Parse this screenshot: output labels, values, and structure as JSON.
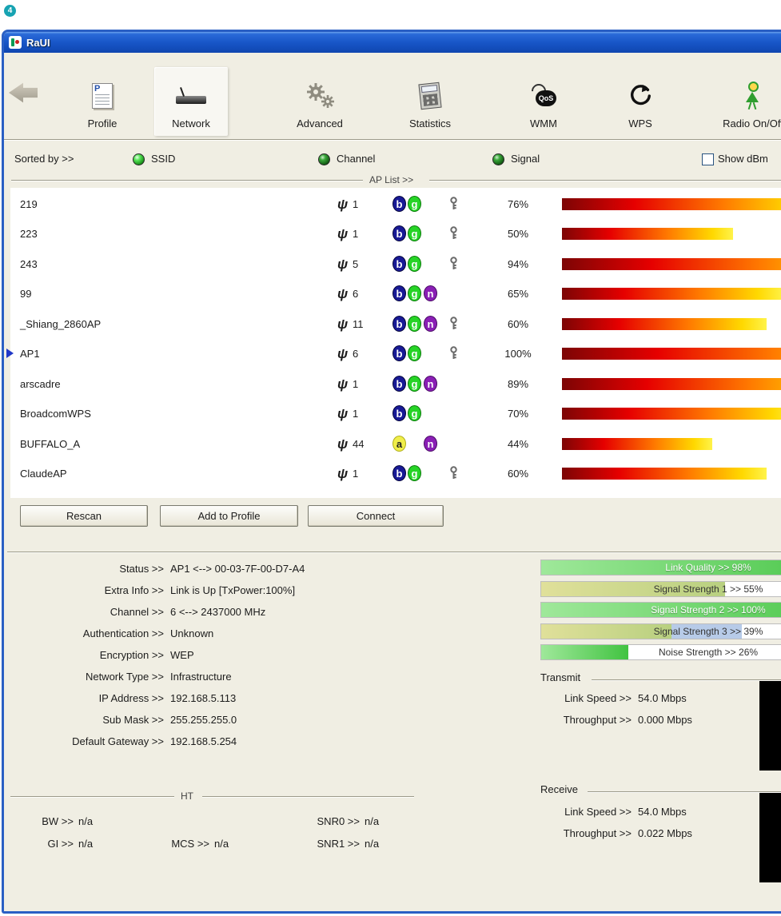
{
  "page": {
    "badge": "4"
  },
  "window": {
    "title": "RaUI"
  },
  "icons": {
    "profile_letter": "P",
    "wmm_text": "QoS",
    "channel_glyph": "psi"
  },
  "toolbar": {
    "items": [
      {
        "label": "Profile"
      },
      {
        "label": "Network"
      },
      {
        "label": "Advanced"
      },
      {
        "label": "Statistics"
      },
      {
        "label": "WMM"
      },
      {
        "label": "WPS"
      },
      {
        "label": "Radio On/Off"
      }
    ]
  },
  "sort_bar": {
    "label": "Sorted by >>",
    "options": [
      {
        "label": "SSID",
        "lit": true
      },
      {
        "label": "Channel",
        "lit": false
      },
      {
        "label": "Signal",
        "lit": false
      }
    ],
    "show_checkbox_label": "Show dBm"
  },
  "ap_list": {
    "group_title": "AP List >>",
    "rows": [
      {
        "ssid": "219",
        "channel": "1",
        "modes": [
          "b",
          "g"
        ],
        "secured": true,
        "signal": 76,
        "signal_label": "76%"
      },
      {
        "ssid": "223",
        "channel": "1",
        "modes": [
          "b",
          "g"
        ],
        "secured": true,
        "signal": 50,
        "signal_label": "50%"
      },
      {
        "ssid": "243",
        "channel": "5",
        "modes": [
          "b",
          "g"
        ],
        "secured": true,
        "signal": 94,
        "signal_label": "94%"
      },
      {
        "ssid": "99",
        "channel": "6",
        "modes": [
          "b",
          "g",
          "n"
        ],
        "secured": false,
        "signal": 65,
        "signal_label": "65%"
      },
      {
        "ssid": "_Shiang_2860AP",
        "channel": "11",
        "modes": [
          "b",
          "g",
          "n"
        ],
        "secured": true,
        "signal": 60,
        "signal_label": "60%"
      },
      {
        "ssid": "AP1",
        "channel": "6",
        "modes": [
          "b",
          "g"
        ],
        "secured": true,
        "signal": 100,
        "signal_label": "100%",
        "selected": true
      },
      {
        "ssid": "arscadre",
        "channel": "1",
        "modes": [
          "b",
          "g",
          "n"
        ],
        "secured": false,
        "signal": 89,
        "signal_label": "89%"
      },
      {
        "ssid": "BroadcomWPS",
        "channel": "1",
        "modes": [
          "b",
          "g"
        ],
        "secured": false,
        "signal": 70,
        "signal_label": "70%"
      },
      {
        "ssid": "BUFFALO_A",
        "channel": "44",
        "modes": [
          "a",
          "n"
        ],
        "secured": false,
        "signal": 44,
        "signal_label": "44%"
      },
      {
        "ssid": "ClaudeAP",
        "channel": "1",
        "modes": [
          "b",
          "g"
        ],
        "secured": true,
        "signal": 60,
        "signal_label": "60%"
      }
    ]
  },
  "actions": {
    "rescan": "Rescan",
    "add_to_profile": "Add to Profile",
    "connect": "Connect"
  },
  "status": {
    "fields": [
      {
        "label": "Status >>",
        "value": "AP1 <--> 00-03-7F-00-D7-A4"
      },
      {
        "label": "Extra Info >>",
        "value": "Link is Up [TxPower:100%]"
      },
      {
        "label": "Channel >>",
        "value": "6 <--> 2437000 MHz"
      },
      {
        "label": "Authentication >>",
        "value": "Unknown"
      },
      {
        "label": "Encryption >>",
        "value": "WEP"
      },
      {
        "label": "Network Type >>",
        "value": "Infrastructure"
      },
      {
        "label": "IP Address >>",
        "value": "192.168.5.113"
      },
      {
        "label": "Sub Mask >>",
        "value": "255.255.255.0"
      },
      {
        "label": "Default Gateway >>",
        "value": "192.168.5.254"
      }
    ],
    "ht": {
      "title": "HT",
      "bw": {
        "label": "BW >>",
        "value": "n/a"
      },
      "gi": {
        "label": "GI >>",
        "value": "n/a"
      },
      "mcs": {
        "label": "MCS >>",
        "value": "n/a"
      },
      "snr0": {
        "label": "SNR0 >>",
        "value": "n/a"
      },
      "snr1": {
        "label": "SNR1 >>",
        "value": "n/a"
      }
    }
  },
  "link_bars": [
    {
      "label": "Link Quality >> 98%",
      "pct": 98,
      "style": "green"
    },
    {
      "label": "Signal Strength 1 >> 55%",
      "pct": 55,
      "style": "olive"
    },
    {
      "label": "Signal Strength 2 >> 100%",
      "pct": 100,
      "style": "green"
    },
    {
      "label": "Signal Strength 3 >> 39%",
      "pct": 39,
      "pct2": 21,
      "style": "olive"
    },
    {
      "label": "Noise Strength >> 26%",
      "pct": 26,
      "style": "green"
    }
  ],
  "transmit": {
    "title": "Transmit",
    "link_speed_label": "Link Speed >>",
    "link_speed": "54.0 Mbps",
    "throughput_label": "Throughput >>",
    "throughput": "0.000 Mbps"
  },
  "receive": {
    "title": "Receive",
    "link_speed_label": "Link Speed >>",
    "link_speed": "54.0 Mbps",
    "throughput_label": "Throughput >>",
    "throughput": "0.022 Mbps"
  }
}
